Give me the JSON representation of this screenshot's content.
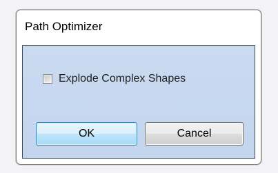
{
  "window": {
    "title": "Path Optimizer"
  },
  "options": {
    "explode_label": "Explode Complex Shapes",
    "explode_checked": false
  },
  "buttons": {
    "ok_label": "OK",
    "cancel_label": "Cancel"
  }
}
